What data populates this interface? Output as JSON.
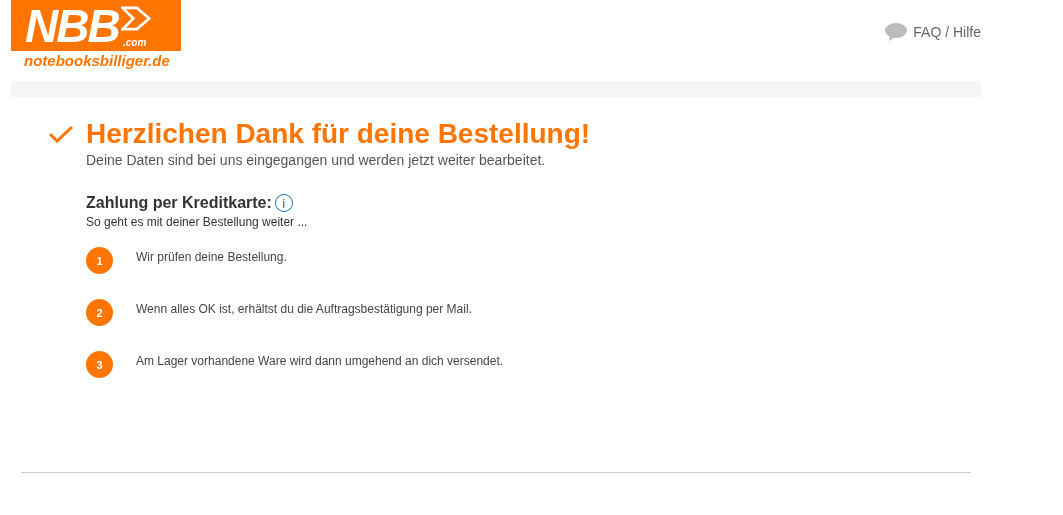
{
  "logo": {
    "mark": "NBB",
    "suffix": ".com",
    "wordmark": "notebooksbilliger.de"
  },
  "header": {
    "help_link": "FAQ / Hilfe"
  },
  "confirmation": {
    "title": "Herzlichen Dank für deine Bestellung!",
    "subtitle": "Deine Daten sind bei uns eingegangen und werden jetzt weiter bearbeitet."
  },
  "payment": {
    "heading": "Zahlung per Kreditkarte:",
    "info_icon": "i",
    "intro": "So geht es mit deiner Bestellung weiter ..."
  },
  "steps": [
    {
      "number": "1",
      "text": "Wir prüfen deine Bestellung."
    },
    {
      "number": "2",
      "text": "Wenn alles OK ist, erhältst du die Auftragsbestätigung per Mail."
    },
    {
      "number": "3",
      "text": "Am Lager vorhandene Ware wird dann umgehend an dich versendet."
    }
  ]
}
